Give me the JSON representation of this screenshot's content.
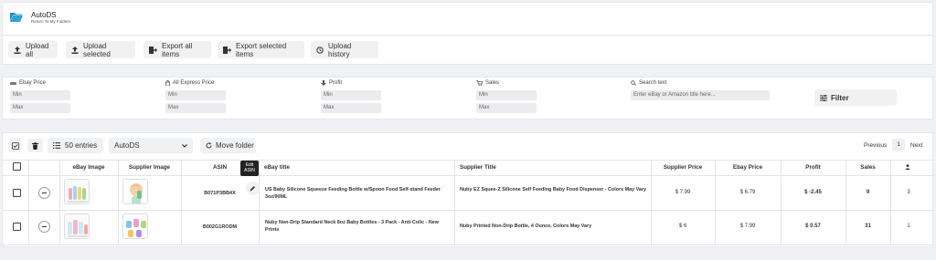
{
  "header": {
    "title": "AutoDS",
    "subtitle": "Return To My Folders"
  },
  "toolbar": {
    "upload_all": "Upload all",
    "upload_selected": "Upload selected",
    "export_all": "Export all items",
    "export_selected": "Export selected items",
    "upload_history": "Upload history"
  },
  "filters": {
    "ebay_price": {
      "label": "Ebay Price",
      "min": "Min",
      "max": "Max"
    },
    "aliexpress_price": {
      "label": "All Express Price",
      "min": "Min",
      "max": "Max"
    },
    "profit": {
      "label": "Profit",
      "min": "Min",
      "max": "Max"
    },
    "sales": {
      "label": "Sales",
      "min": "Min",
      "max": "Max"
    },
    "search": {
      "label": "Search text",
      "placeholder": "Enter eBay or Amazon title here..."
    },
    "filter_button": "Filter"
  },
  "table_toolbar": {
    "entries": "50 entries",
    "folder": "AutoDS",
    "move_folder": "Move folder",
    "previous": "Previous",
    "page": "1",
    "next": "Next"
  },
  "table": {
    "headers": {
      "ebay_image": "eBay Image",
      "supplier_image": "Supplier Image",
      "asin": "ASIN",
      "ebay_title": "eBay title",
      "supplier_title": "Supplier Title",
      "supplier_price": "Supplier Price",
      "ebay_price": "Ebay Price",
      "profit": "Profit",
      "sales": "Sales"
    },
    "tooltip": {
      "line1": "Edit",
      "line2": "ASIN"
    },
    "rows": [
      {
        "asin": "B071P3BB4X",
        "ebay_title": "US Baby Silicone Squeeze Feeding Bottle w/Spoon Food Self-stand Feeder 3oz/90ML",
        "supplier_title": "Nuby EZ Squee-Z Silicone Self Feeding Baby Food Dispenser - Colors May Vary",
        "supplier_price": "$ 7.99",
        "ebay_price": "$ 6.79",
        "profit": "$ -2.45",
        "sales": "9",
        "last": "3"
      },
      {
        "asin": "B002G1RODM",
        "ebay_title": "Nuby Non-Drip Standard Neck 8oz Baby Bottles - 3 Pack - Anti-Colic - New Prints",
        "supplier_title": "Nuby Printed Non-Drip Bottle, 4 Ounce, Colors May Vary",
        "supplier_price": "$ 6",
        "ebay_price": "$ 7.99",
        "profit": "$ 0.57",
        "sales": "31",
        "last": "1"
      }
    ]
  },
  "colors": {
    "folder_icon": "#2fa3d6",
    "tooltip_bg": "#222222"
  }
}
